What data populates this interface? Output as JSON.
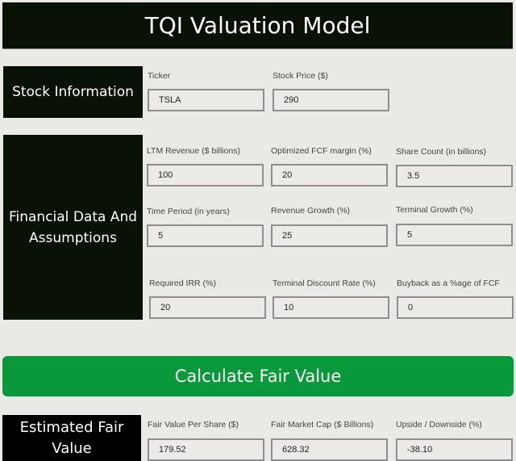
{
  "header": {
    "title": "TQI Valuation Model"
  },
  "stock_info": {
    "section_label": "Stock Information",
    "fields": [
      {
        "label": "Ticker",
        "value": "TSLA"
      },
      {
        "label": "Stock Price ($)",
        "value": "290"
      }
    ]
  },
  "financial": {
    "section_label": "Financial Data And Assumptions",
    "fields": [
      {
        "label": "LTM Revenue ($ billions)",
        "value": "100"
      },
      {
        "label": "Optimized FCF margin (%)",
        "value": "20"
      },
      {
        "label": "Share Count (in billions)",
        "value": "3.5"
      },
      {
        "label": "Time Period (in years)",
        "value": "5"
      },
      {
        "label": "Revenue Growth (%)",
        "value": "25"
      },
      {
        "label": "Terminal Growth (%)",
        "value": "5"
      },
      {
        "label": "Required IRR (%)",
        "value": "20"
      },
      {
        "label": "Terminal Discount Rate (%)",
        "value": "10"
      },
      {
        "label": "Buyback as a %age of FCF",
        "value": "0"
      }
    ]
  },
  "calculate_button": {
    "label": "Calculate Fair Value",
    "color": "#07993a"
  },
  "results": {
    "section_label": "Estimated Fair Value",
    "fields": [
      {
        "label": "Fair Value Per Share ($)",
        "value": "179.52"
      },
      {
        "label": "Fair Market Cap ($ Billions)",
        "value": "628.32"
      },
      {
        "label": "Upside / Downside (%)",
        "value": "-38.10"
      }
    ]
  }
}
